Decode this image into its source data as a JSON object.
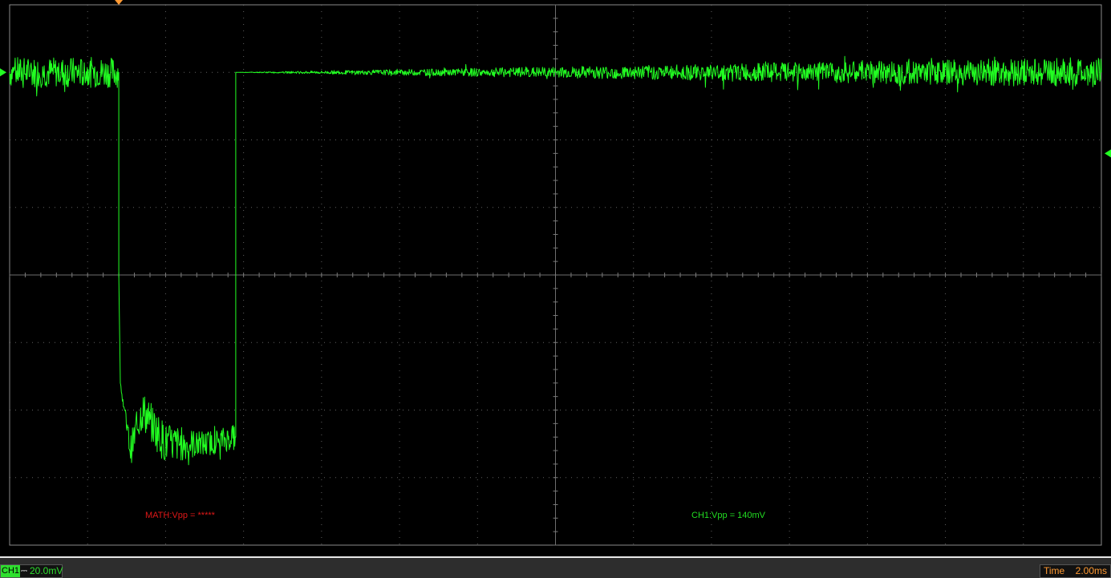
{
  "colors": {
    "background": "#000000",
    "grid": "#7a7a7a",
    "ch1_trace": "#22ff22",
    "math_measure": "#e01818",
    "trigger_marker": "#ff9a33",
    "status_bar": "#2d2d2d"
  },
  "markers": {
    "trigger_icon": "orange-down-triangle",
    "ch1_ground_icon": "green-right-arrow",
    "trigger_level_icon": "green-left-arrow"
  },
  "measurements": {
    "math": "MATH:Vpp = *****",
    "ch1": "CH1:Vpp = 140mV"
  },
  "status": {
    "ch1_tag": "CH1",
    "ch1_coupling": "⎓",
    "ch1_scale": "20.0mV",
    "time_label": "Time",
    "time_value": "2.00ms"
  },
  "chart_data": {
    "type": "line",
    "title": "",
    "xlabel": "",
    "ylabel": "",
    "x_unit": "divisions",
    "y_unit": "divisions",
    "xlim": [
      0,
      14
    ],
    "ylim": [
      -4,
      4
    ],
    "grid": true,
    "series": [
      {
        "x": [
          0,
          1.4,
          1.4,
          1.42,
          1.55,
          1.7,
          2.0,
          2.5,
          2.9,
          2.9,
          14
        ],
        "y": [
          3.0,
          3.0,
          0.0,
          -1.6,
          -2.6,
          -2.0,
          -2.5,
          -2.5,
          -2.4,
          3.0,
          3.0
        ],
        "noise_pp": [
          0.6,
          0.6,
          0,
          0,
          0.6,
          0.8,
          0.8,
          0.5,
          0.5,
          0,
          0.6
        ]
      }
    ]
  }
}
